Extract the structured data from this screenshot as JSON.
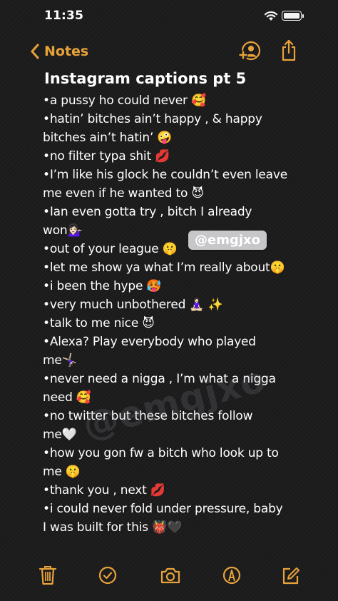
{
  "status_bar": {
    "time": "11:35"
  },
  "nav": {
    "back_label": "Notes"
  },
  "note": {
    "title": "Instagram captions pt 5",
    "lines": [
      "•a pussy ho could never 🥰",
      "•hatin’ bitches ain’t happy , & happy",
      "bitches ain’t hatin’ 🤪",
      "•no filter typa shit 💋",
      "•I’m like his glock he couldn’t even leave",
      "me even if he wanted to 😈",
      "•Ian even gotta try , bitch I already",
      "won💁🏻‍♀️",
      "•out of your league 🤫",
      "•let me show ya what I’m really about🤫",
      "•i been the hype 🥵",
      "•very much unbothered 🧘🏻‍♀️ ✨",
      "•talk to me nice 😈",
      "•Alexa? Play everybody who played",
      "me🤸🏻‍♀️",
      "•never need a nigga , I’m what a nigga",
      "need 🥰",
      "•no twitter but these bitches follow",
      "me🤍",
      "•how you gon fw a bitch who look up to",
      "me 🤫",
      "•thank you , next 💋",
      "•i could never fold under pressure, baby",
      "I was built for this 👹🖤"
    ]
  },
  "sticker": {
    "text": "@emgjxo"
  },
  "watermark": {
    "text": "@emgjxo"
  },
  "colors": {
    "accent": "#e8a23a",
    "background": "#1b1b1c",
    "text": "#ffffff"
  },
  "icons": {
    "back": "chevron-left-icon",
    "add_person": "add-person-icon",
    "share": "share-icon",
    "trash": "trash-icon",
    "checklist": "checklist-icon",
    "camera": "camera-icon",
    "markup": "markup-pen-icon",
    "compose": "compose-icon"
  }
}
